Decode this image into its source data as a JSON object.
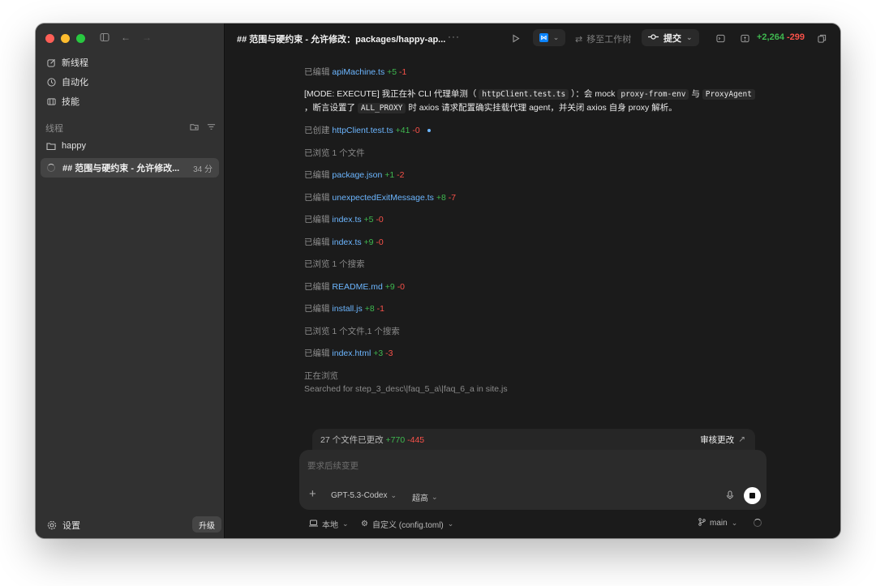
{
  "sidebar": {
    "nav": [
      {
        "label": "新线程",
        "icon": "compose-icon"
      },
      {
        "label": "自动化",
        "icon": "clock-icon"
      },
      {
        "label": "技能",
        "icon": "book-icon"
      }
    ],
    "section_label": "线程",
    "folder": "happy",
    "thread": {
      "name": "## 范围与硬约束 - 允许修改...",
      "time": "34 分"
    },
    "settings_label": "设置",
    "upgrade_label": "升级"
  },
  "topbar": {
    "title": "## 范围与硬约束 - 允许修改：packages/happy-ap...",
    "more": "···",
    "worktree_label": "移至工作树",
    "commit_label": "提交",
    "additions": "+2,264",
    "deletions": "-299"
  },
  "log": [
    {
      "action": "已编辑",
      "file": "apiMachine.ts",
      "add": "+5",
      "del": "-1"
    },
    {
      "action": "已创建",
      "file": "httpClient.test.ts",
      "add": "+41",
      "del": "-0"
    },
    {
      "action": "已浏览",
      "detail": "1 个文件"
    },
    {
      "action": "已编辑",
      "file": "package.json",
      "add": "+1",
      "del": "-2"
    },
    {
      "action": "已编辑",
      "file": "unexpectedExitMessage.ts",
      "add": "+8",
      "del": "-7"
    },
    {
      "action": "已编辑",
      "file": "index.ts",
      "add": "+5",
      "del": "-0"
    },
    {
      "action": "已编辑",
      "file": "index.ts",
      "add": "+9",
      "del": "-0"
    },
    {
      "action": "已浏览",
      "detail": "1 个搜索"
    },
    {
      "action": "已编辑",
      "file": "README.md",
      "add": "+9",
      "del": "-0"
    },
    {
      "action": "已编辑",
      "file": "install.js",
      "add": "+8",
      "del": "-1"
    },
    {
      "action": "已浏览",
      "detail": "1 个文件,1 个搜索"
    },
    {
      "action": "已编辑",
      "file": "index.html",
      "add": "+3",
      "del": "-3"
    }
  ],
  "message": {
    "part1": "[MODE: EXECUTE] 我正在补 CLI 代理单测（",
    "code1": "httpClient.test.ts",
    "part2": "）：会 mock",
    "code2": "proxy-from-env",
    "part3": "与",
    "code3": "ProxyAgent",
    "part4": "，断言设置了",
    "code4": "ALL_PROXY",
    "part5": "时 axios 请求配置确实挂载代理 agent，并关闭 axios 自身 proxy 解析。"
  },
  "status": {
    "browsing": "正在浏览",
    "searched": "Searched for step_3_desc\\|faq_5_a\\|faq_6_a in site.js"
  },
  "changes": {
    "label": "27 个文件已更改",
    "add": "+770",
    "del": "-445",
    "review": "审核更改"
  },
  "composer": {
    "placeholder": "要求后续变更",
    "model": "GPT-5.3-Codex",
    "effort": "超高"
  },
  "bottom": {
    "local": "本地",
    "config": "自定义 (config.toml)",
    "branch": "main"
  }
}
